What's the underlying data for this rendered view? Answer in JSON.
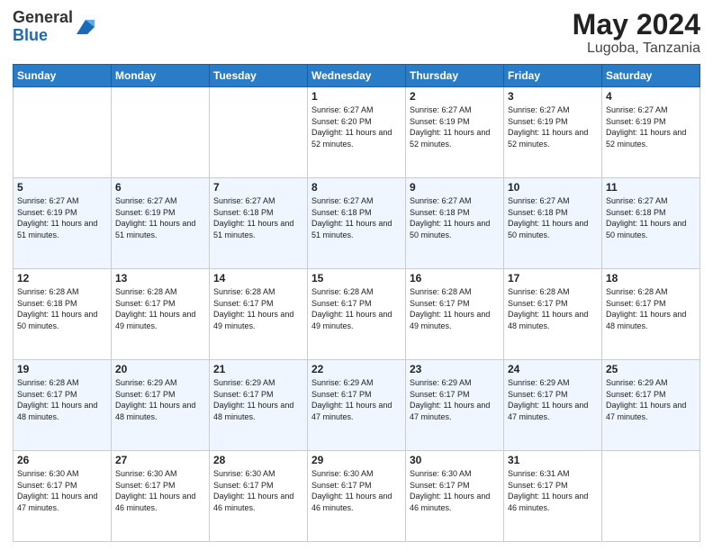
{
  "header": {
    "logo_general": "General",
    "logo_blue": "Blue",
    "title": "May 2024",
    "location": "Lugoba, Tanzania"
  },
  "weekdays": [
    "Sunday",
    "Monday",
    "Tuesday",
    "Wednesday",
    "Thursday",
    "Friday",
    "Saturday"
  ],
  "weeks": [
    [
      {
        "day": "",
        "sunrise": "",
        "sunset": "",
        "daylight": ""
      },
      {
        "day": "",
        "sunrise": "",
        "sunset": "",
        "daylight": ""
      },
      {
        "day": "",
        "sunrise": "",
        "sunset": "",
        "daylight": ""
      },
      {
        "day": "1",
        "sunrise": "Sunrise: 6:27 AM",
        "sunset": "Sunset: 6:20 PM",
        "daylight": "Daylight: 11 hours and 52 minutes."
      },
      {
        "day": "2",
        "sunrise": "Sunrise: 6:27 AM",
        "sunset": "Sunset: 6:19 PM",
        "daylight": "Daylight: 11 hours and 52 minutes."
      },
      {
        "day": "3",
        "sunrise": "Sunrise: 6:27 AM",
        "sunset": "Sunset: 6:19 PM",
        "daylight": "Daylight: 11 hours and 52 minutes."
      },
      {
        "day": "4",
        "sunrise": "Sunrise: 6:27 AM",
        "sunset": "Sunset: 6:19 PM",
        "daylight": "Daylight: 11 hours and 52 minutes."
      }
    ],
    [
      {
        "day": "5",
        "sunrise": "Sunrise: 6:27 AM",
        "sunset": "Sunset: 6:19 PM",
        "daylight": "Daylight: 11 hours and 51 minutes."
      },
      {
        "day": "6",
        "sunrise": "Sunrise: 6:27 AM",
        "sunset": "Sunset: 6:19 PM",
        "daylight": "Daylight: 11 hours and 51 minutes."
      },
      {
        "day": "7",
        "sunrise": "Sunrise: 6:27 AM",
        "sunset": "Sunset: 6:18 PM",
        "daylight": "Daylight: 11 hours and 51 minutes."
      },
      {
        "day": "8",
        "sunrise": "Sunrise: 6:27 AM",
        "sunset": "Sunset: 6:18 PM",
        "daylight": "Daylight: 11 hours and 51 minutes."
      },
      {
        "day": "9",
        "sunrise": "Sunrise: 6:27 AM",
        "sunset": "Sunset: 6:18 PM",
        "daylight": "Daylight: 11 hours and 50 minutes."
      },
      {
        "day": "10",
        "sunrise": "Sunrise: 6:27 AM",
        "sunset": "Sunset: 6:18 PM",
        "daylight": "Daylight: 11 hours and 50 minutes."
      },
      {
        "day": "11",
        "sunrise": "Sunrise: 6:27 AM",
        "sunset": "Sunset: 6:18 PM",
        "daylight": "Daylight: 11 hours and 50 minutes."
      }
    ],
    [
      {
        "day": "12",
        "sunrise": "Sunrise: 6:28 AM",
        "sunset": "Sunset: 6:18 PM",
        "daylight": "Daylight: 11 hours and 50 minutes."
      },
      {
        "day": "13",
        "sunrise": "Sunrise: 6:28 AM",
        "sunset": "Sunset: 6:17 PM",
        "daylight": "Daylight: 11 hours and 49 minutes."
      },
      {
        "day": "14",
        "sunrise": "Sunrise: 6:28 AM",
        "sunset": "Sunset: 6:17 PM",
        "daylight": "Daylight: 11 hours and 49 minutes."
      },
      {
        "day": "15",
        "sunrise": "Sunrise: 6:28 AM",
        "sunset": "Sunset: 6:17 PM",
        "daylight": "Daylight: 11 hours and 49 minutes."
      },
      {
        "day": "16",
        "sunrise": "Sunrise: 6:28 AM",
        "sunset": "Sunset: 6:17 PM",
        "daylight": "Daylight: 11 hours and 49 minutes."
      },
      {
        "day": "17",
        "sunrise": "Sunrise: 6:28 AM",
        "sunset": "Sunset: 6:17 PM",
        "daylight": "Daylight: 11 hours and 48 minutes."
      },
      {
        "day": "18",
        "sunrise": "Sunrise: 6:28 AM",
        "sunset": "Sunset: 6:17 PM",
        "daylight": "Daylight: 11 hours and 48 minutes."
      }
    ],
    [
      {
        "day": "19",
        "sunrise": "Sunrise: 6:28 AM",
        "sunset": "Sunset: 6:17 PM",
        "daylight": "Daylight: 11 hours and 48 minutes."
      },
      {
        "day": "20",
        "sunrise": "Sunrise: 6:29 AM",
        "sunset": "Sunset: 6:17 PM",
        "daylight": "Daylight: 11 hours and 48 minutes."
      },
      {
        "day": "21",
        "sunrise": "Sunrise: 6:29 AM",
        "sunset": "Sunset: 6:17 PM",
        "daylight": "Daylight: 11 hours and 48 minutes."
      },
      {
        "day": "22",
        "sunrise": "Sunrise: 6:29 AM",
        "sunset": "Sunset: 6:17 PM",
        "daylight": "Daylight: 11 hours and 47 minutes."
      },
      {
        "day": "23",
        "sunrise": "Sunrise: 6:29 AM",
        "sunset": "Sunset: 6:17 PM",
        "daylight": "Daylight: 11 hours and 47 minutes."
      },
      {
        "day": "24",
        "sunrise": "Sunrise: 6:29 AM",
        "sunset": "Sunset: 6:17 PM",
        "daylight": "Daylight: 11 hours and 47 minutes."
      },
      {
        "day": "25",
        "sunrise": "Sunrise: 6:29 AM",
        "sunset": "Sunset: 6:17 PM",
        "daylight": "Daylight: 11 hours and 47 minutes."
      }
    ],
    [
      {
        "day": "26",
        "sunrise": "Sunrise: 6:30 AM",
        "sunset": "Sunset: 6:17 PM",
        "daylight": "Daylight: 11 hours and 47 minutes."
      },
      {
        "day": "27",
        "sunrise": "Sunrise: 6:30 AM",
        "sunset": "Sunset: 6:17 PM",
        "daylight": "Daylight: 11 hours and 46 minutes."
      },
      {
        "day": "28",
        "sunrise": "Sunrise: 6:30 AM",
        "sunset": "Sunset: 6:17 PM",
        "daylight": "Daylight: 11 hours and 46 minutes."
      },
      {
        "day": "29",
        "sunrise": "Sunrise: 6:30 AM",
        "sunset": "Sunset: 6:17 PM",
        "daylight": "Daylight: 11 hours and 46 minutes."
      },
      {
        "day": "30",
        "sunrise": "Sunrise: 6:30 AM",
        "sunset": "Sunset: 6:17 PM",
        "daylight": "Daylight: 11 hours and 46 minutes."
      },
      {
        "day": "31",
        "sunrise": "Sunrise: 6:31 AM",
        "sunset": "Sunset: 6:17 PM",
        "daylight": "Daylight: 11 hours and 46 minutes."
      },
      {
        "day": "",
        "sunrise": "",
        "sunset": "",
        "daylight": ""
      }
    ]
  ]
}
